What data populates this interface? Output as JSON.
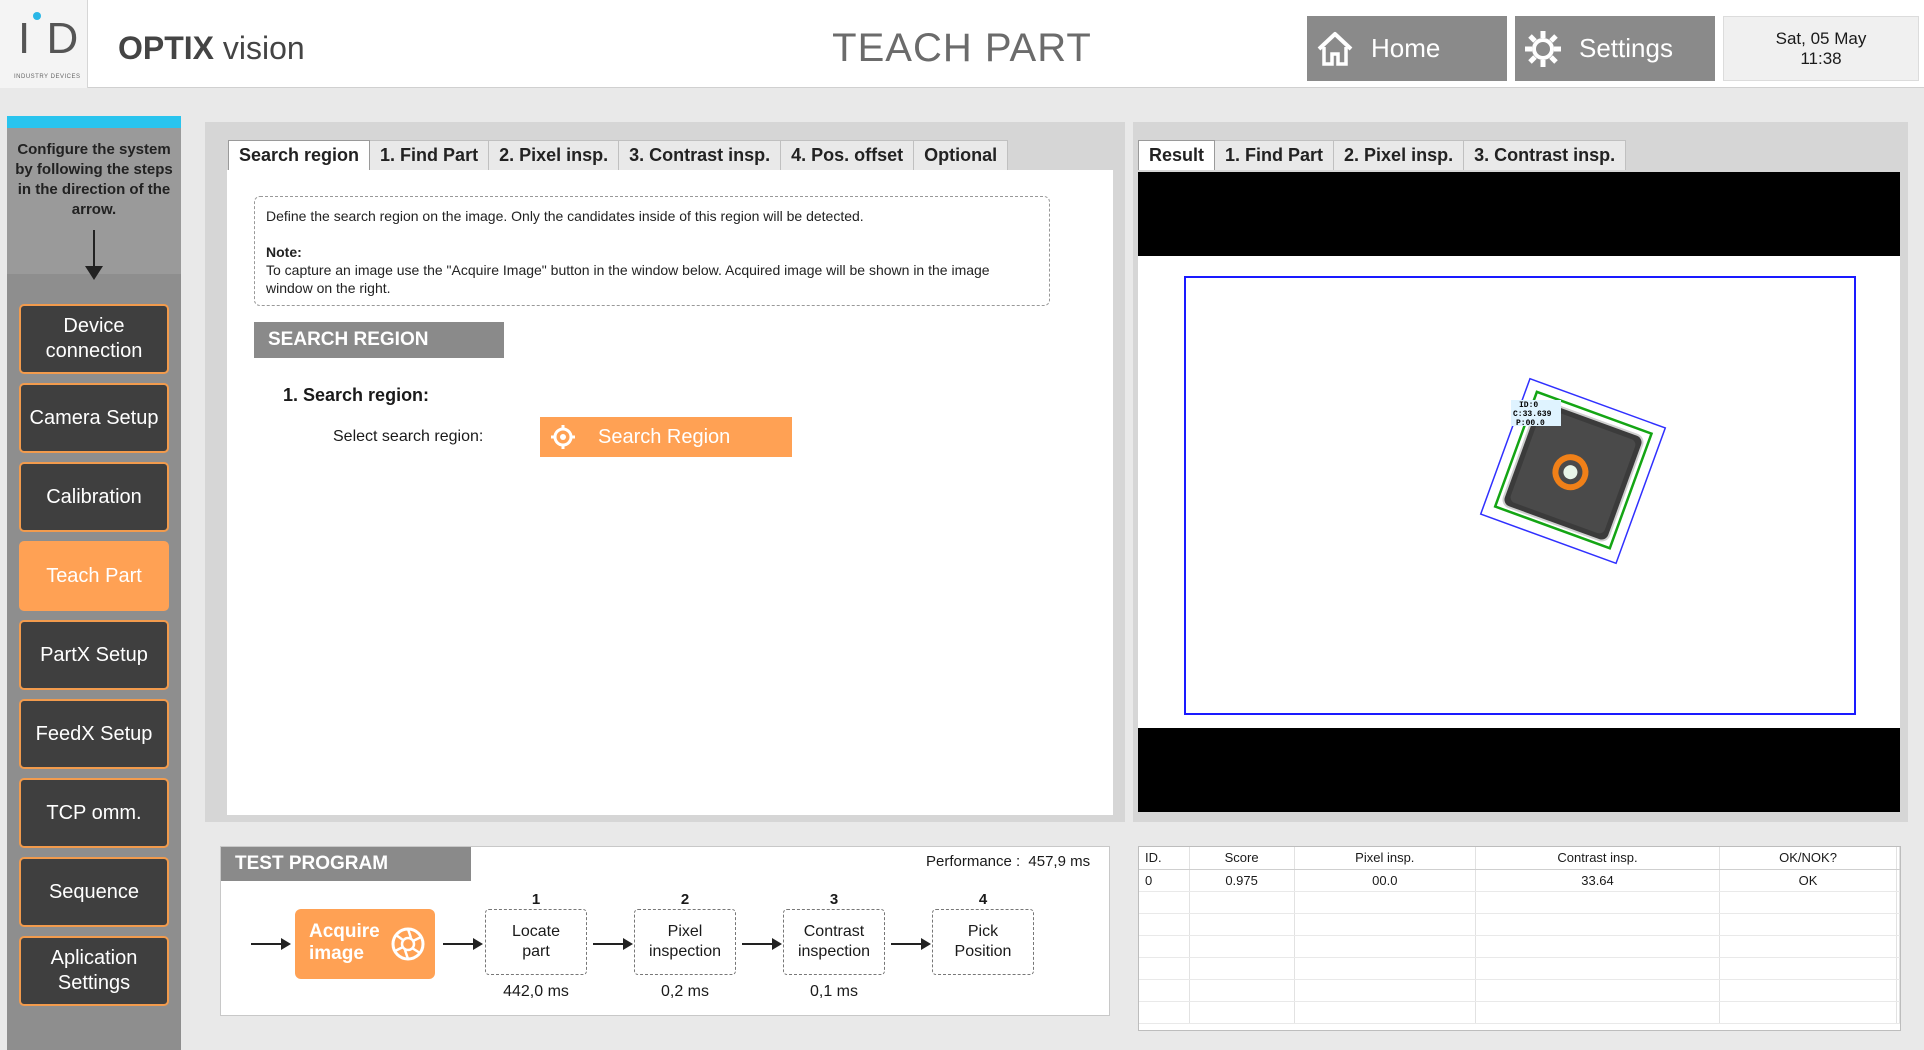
{
  "header": {
    "logo_letters": "I D",
    "logo_subtitle": "INDUSTRY DEVICES",
    "app_name_bold": "OPTIX",
    "app_name_rest": "vision",
    "page_title": "TEACH PART",
    "home_label": "Home",
    "settings_label": "Settings",
    "date": "Sat, 05 May",
    "time": "11:38"
  },
  "sidebar": {
    "help_text": "Configure the system by following the steps in the direction of the arrow.",
    "items": [
      {
        "label": "Device connection",
        "active": false
      },
      {
        "label": "Camera Setup",
        "active": false
      },
      {
        "label": "Calibration",
        "active": false
      },
      {
        "label": "Teach Part",
        "active": true
      },
      {
        "label": "PartX Setup",
        "active": false
      },
      {
        "label": "FeedX Setup",
        "active": false
      },
      {
        "label": "TCP omm.",
        "active": false
      },
      {
        "label": "Sequence",
        "active": false
      },
      {
        "label": "Aplication Settings",
        "active": false
      }
    ]
  },
  "center": {
    "tabs": [
      "Search region",
      "1. Find Part",
      "2. Pixel insp.",
      "3. Contrast insp.",
      "4. Pos. offset",
      "Optional"
    ],
    "info_text": "Define the search region on the image. Only the candidates inside of this region will be detected.",
    "note_title": "Note:",
    "note_text": "To capture an image use the \"Acquire Image\" button in the window below. Acquired image will be shown in the image window on the right.",
    "section_header": "SEARCH REGION",
    "step_title": "1. Search region:",
    "search_label": "Select search region:",
    "search_button": "Search Region"
  },
  "test_program": {
    "header": "TEST PROGRAM",
    "performance_label": "Performance :",
    "performance_value": "457,9 ms",
    "acquire_line1": "Acquire",
    "acquire_line2": "image",
    "steps": [
      {
        "num": "1",
        "line1": "Locate",
        "line2": "part",
        "time": "442,0 ms"
      },
      {
        "num": "2",
        "line1": "Pixel",
        "line2": "inspection",
        "time": "0,2 ms"
      },
      {
        "num": "3",
        "line1": "Contrast",
        "line2": "inspection",
        "time": "0,1 ms"
      },
      {
        "num": "4",
        "line1": "Pick",
        "line2": "Position",
        "time": ""
      }
    ]
  },
  "result": {
    "tabs": [
      "Result",
      "1. Find Part",
      "2. Pixel insp.",
      "3. Contrast insp."
    ],
    "overlay_text": [
      "ID:0",
      "C:33.639",
      "P:00.0"
    ],
    "table_headers": [
      "ID.",
      "Score",
      "Pixel insp.",
      "Contrast insp.",
      "OK/NOK?",
      ""
    ],
    "table_rows": [
      [
        "0",
        "0.975",
        "00.0",
        "33.64",
        "OK",
        ""
      ]
    ],
    "empty_rows": 6
  },
  "colors": {
    "accent": "#ffa154",
    "sidebar_top": "#29c4ee",
    "search_rect": "#1a1aff",
    "part_rect": "#14a514"
  }
}
